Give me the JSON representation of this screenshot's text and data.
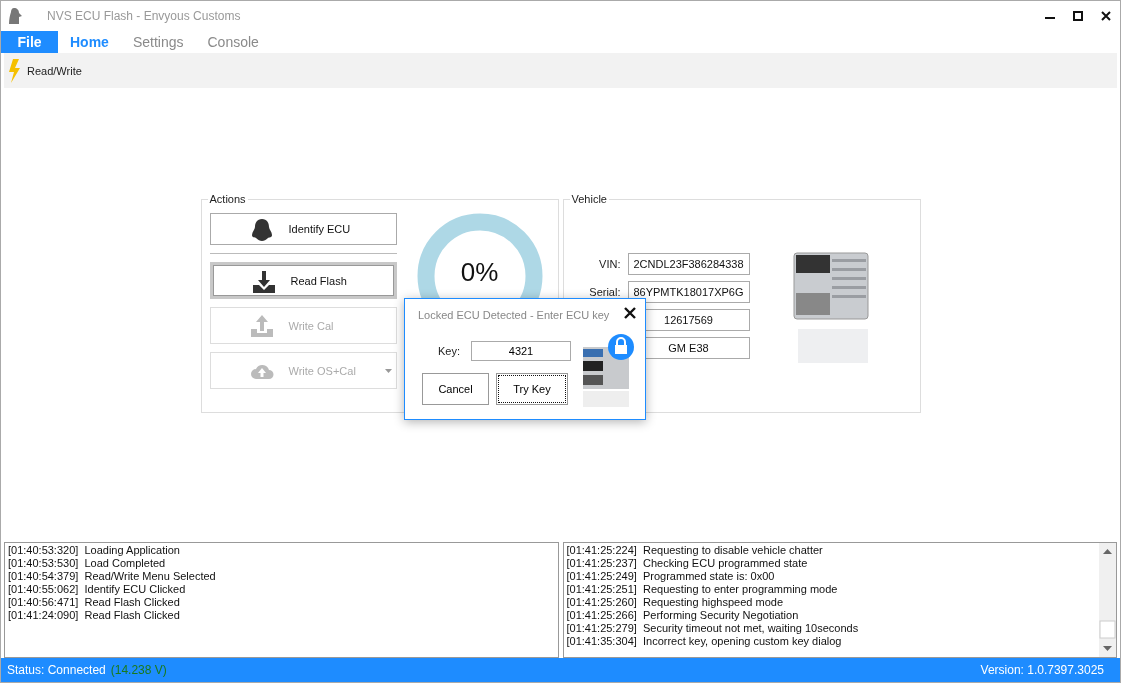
{
  "window": {
    "title": "NVS ECU Flash - Envyous Customs"
  },
  "file_menu": {
    "label": "File"
  },
  "tabs": [
    {
      "label": "Home",
      "selected": true
    },
    {
      "label": "Settings",
      "selected": false
    },
    {
      "label": "Console",
      "selected": false
    }
  ],
  "ribbon": {
    "items": [
      {
        "label": "Read/Write"
      }
    ]
  },
  "actions": {
    "title": "Actions",
    "buttons": [
      {
        "label": "Identify ECU",
        "kind": "identify",
        "disabled": false,
        "focused": false,
        "has_menu": false
      },
      {
        "label": "Read Flash",
        "kind": "download",
        "disabled": false,
        "focused": true,
        "has_menu": false
      },
      {
        "label": "Write Cal",
        "kind": "upload",
        "disabled": true,
        "focused": false,
        "has_menu": false
      },
      {
        "label": "Write OS+Cal",
        "kind": "cloud",
        "disabled": true,
        "focused": false,
        "has_menu": true
      }
    ],
    "progress": {
      "reading": "0%"
    }
  },
  "vehicle": {
    "title": "Vehicle",
    "fields": [
      {
        "label": "VIN:",
        "value": "2CNDL23F386284338"
      },
      {
        "label": "Serial:",
        "value": "86YPMTK18017XP6G"
      },
      {
        "value": "12617569"
      },
      {
        "value": "GM E38"
      }
    ]
  },
  "dialog": {
    "title": "Locked ECU Detected - Enter ECU key",
    "key_label": "Key:",
    "key_value": "4321",
    "buttons": [
      {
        "label": "Cancel",
        "focused": false
      },
      {
        "label": "Try Key",
        "focused": true
      }
    ]
  },
  "log_left": [
    "[01:40:53:320]  Loading Application",
    "[01:40:53:530]  Load Completed",
    "[01:40:54:379]  Read/Write Menu Selected",
    "[01:40:55:062]  Identify ECU Clicked",
    "[01:40:56:471]  Read Flash Clicked",
    "[01:41:24:090]  Read Flash Clicked"
  ],
  "log_right": [
    "[01:41:25:224]  Requesting to disable vehicle chatter",
    "[01:41:25:237]  Checking ECU programmed state",
    "[01:41:25:249]  Programmed state is: 0x00",
    "[01:41:25:251]  Requesting to enter programming mode",
    "[01:41:25:260]  Requesting highspeed mode",
    "[01:41:25:266]  Performing Security Negotiation",
    "[01:41:25:279]  Security timeout not met, waiting 10seconds",
    "[01:41:35:304]  Incorrect key, opening custom key dialog"
  ],
  "status_bar": {
    "status": "Status: Connected",
    "voltage": "(14.238 V)",
    "version": "Version: 1.0.7397.3025"
  }
}
